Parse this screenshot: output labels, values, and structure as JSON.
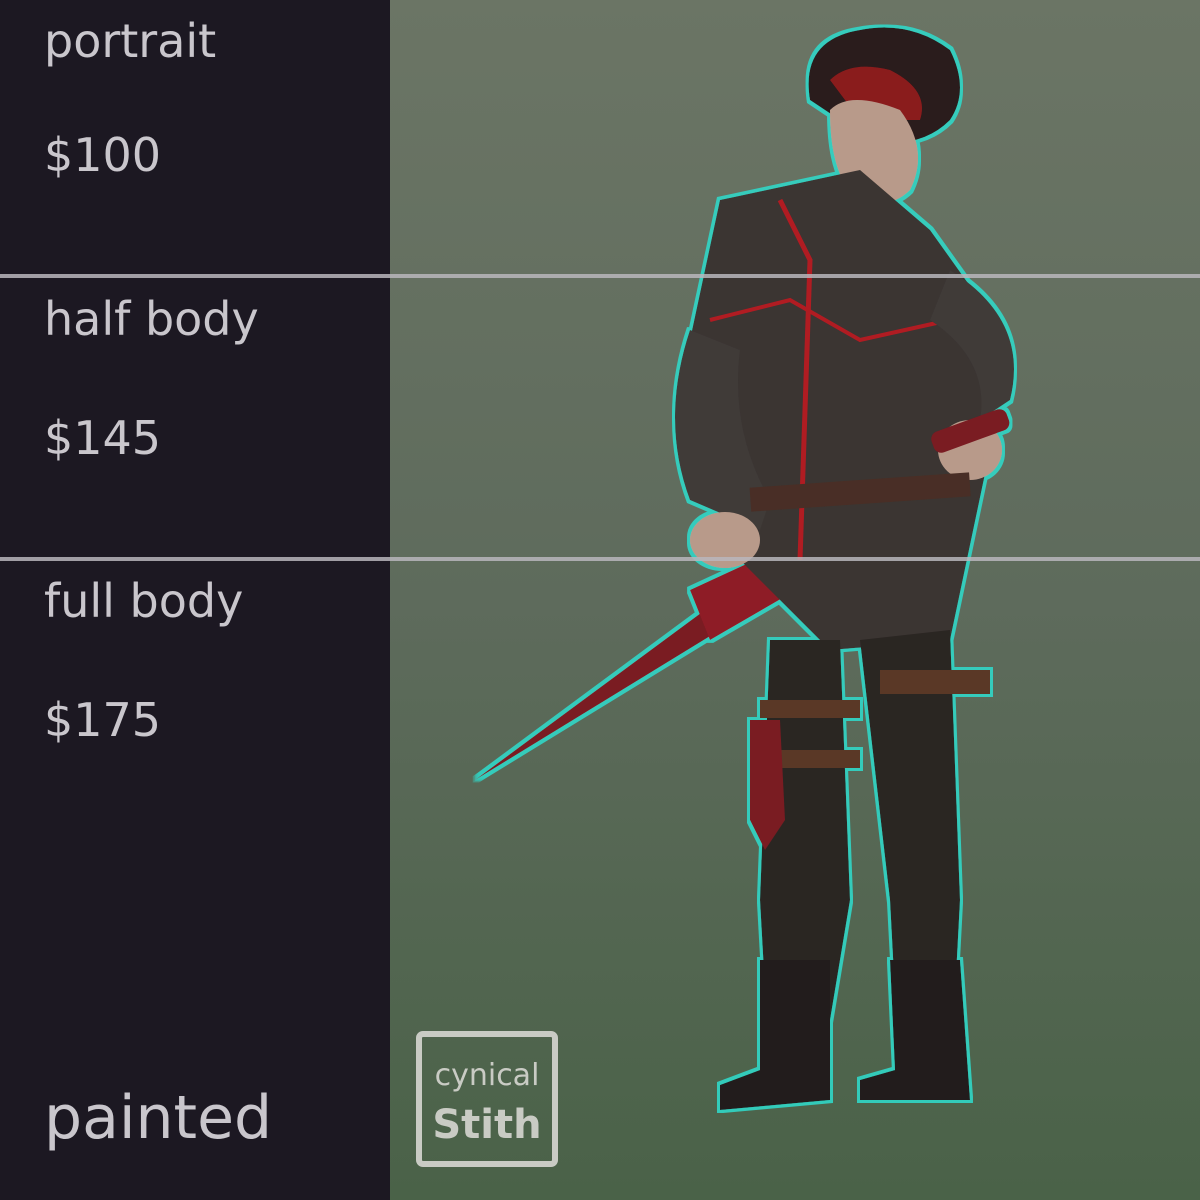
{
  "tiers": [
    {
      "label": "portrait",
      "price": "$100"
    },
    {
      "label": "half body",
      "price": "$145"
    },
    {
      "label": "full body",
      "price": "$175"
    }
  ],
  "style_label": "painted",
  "signature": {
    "line1": "cynical",
    "line2": "Stith"
  },
  "colors": {
    "sidebar_bg": "#1c1822",
    "text": "#c9c6cc",
    "background_top": "#6b7565",
    "background_bottom": "#4a6248",
    "accent_red": "#b01c24",
    "rim_light": "#2fd6c6"
  }
}
